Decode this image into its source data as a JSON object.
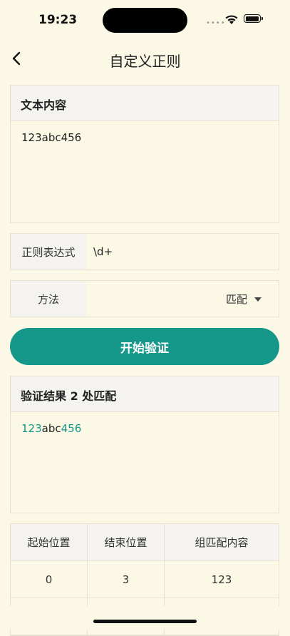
{
  "status": {
    "time": "19:23"
  },
  "nav": {
    "title": "自定义正则"
  },
  "text_section": {
    "header": "文本内容",
    "content": "123abc456"
  },
  "regex_row": {
    "label": "正则表达式",
    "value": "\\d+"
  },
  "method_row": {
    "label": "方法",
    "selected": "匹配"
  },
  "start_button": {
    "label": "开始验证"
  },
  "result_section": {
    "header": "验证结果 2 处匹配",
    "segments": [
      "123",
      "abc",
      "456"
    ]
  },
  "table": {
    "headers": [
      "起始位置",
      "结束位置",
      "组匹配内容"
    ],
    "rows": [
      {
        "start": "0",
        "end": "3",
        "content": "123"
      }
    ]
  },
  "colors": {
    "accent": "#15978A",
    "background": "#FCF8E6"
  },
  "icons": [
    "back-icon",
    "wifi-icon",
    "battery-icon",
    "signal-icon",
    "dropdown-caret-icon"
  ]
}
